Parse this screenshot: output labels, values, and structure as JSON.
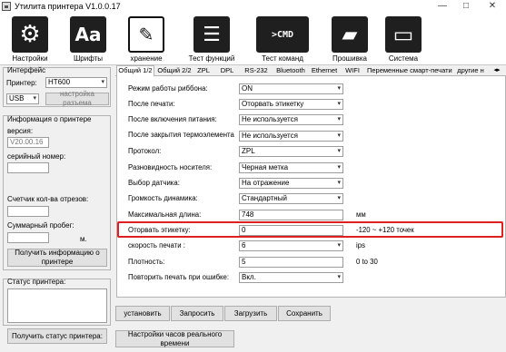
{
  "window": {
    "title": "Утилита принтера  V1.0.0.17",
    "minimize_glyph": "—",
    "maximize_glyph": "□",
    "close_glyph": "✕"
  },
  "toolbar": {
    "items": [
      {
        "label": "Настройки",
        "icon": "gear-icon",
        "glyph": "⚙"
      },
      {
        "label": "Шрифты",
        "icon": "font-icon",
        "glyph": "Aa"
      },
      {
        "label": "хранение",
        "icon": "storage-icon",
        "glyph": "✎"
      },
      {
        "label": "Тест функций",
        "icon": "list-icon",
        "glyph": "☰"
      },
      {
        "label": "Тест команд",
        "icon": "command-icon",
        "glyph": ">CMD"
      },
      {
        "label": "Прошивка",
        "icon": "chip-icon",
        "glyph": "▰"
      },
      {
        "label": "Система",
        "icon": "monitor-icon",
        "glyph": "▭"
      }
    ]
  },
  "left": {
    "interface_group": "Интерфейс",
    "printer_label": "Принтер:",
    "printer_value": "HT600",
    "port_value": "USB",
    "port_settings_button": "настройка разъема",
    "info_group": "Информация о принтере",
    "version_label": "версия:",
    "version_value": "V20.00.16",
    "serial_label": "серийный номер:",
    "serial_value": "",
    "cut_counter_label": "Счетчик кол-ва отрезов:",
    "cut_counter_value": "",
    "total_run_label": "Суммарный пробег:",
    "total_run_value": "",
    "total_run_unit": "м.",
    "get_info_button": "Получить информацию о принтере",
    "status_group": "Статус принтера:",
    "status_value": "",
    "get_status_button": "Получить статус принтера:"
  },
  "tabs": [
    "Общий 1/2",
    "Общий 2/2",
    "ZPL",
    "DPL",
    "RS-232",
    "Bluetooth",
    "Ethernet",
    "WIFI",
    "Переменные смарт-печати",
    "другие н"
  ],
  "tab_scroll_glyph": "◂▸",
  "settings": {
    "rows": [
      {
        "label": "Режим работы риббона:",
        "type": "combo",
        "value": "ON",
        "unit": ""
      },
      {
        "label": "После печати:",
        "type": "combo",
        "value": "Оторвать этикетку",
        "unit": ""
      },
      {
        "label": "После включения питания:",
        "type": "combo",
        "value": "Не используется",
        "unit": ""
      },
      {
        "label": "После закрытия термоэлемента",
        "type": "combo",
        "value": "Не используется",
        "unit": ""
      },
      {
        "label": "Протокол:",
        "type": "combo",
        "value": "ZPL",
        "unit": ""
      },
      {
        "label": "Разновидность носителя:",
        "type": "combo",
        "value": "Черная метка",
        "unit": ""
      },
      {
        "label": "Выбор датчика:",
        "type": "combo",
        "value": "На отражение",
        "unit": ""
      },
      {
        "label": "Громкость динамика:",
        "type": "combo",
        "value": "Стандартный",
        "unit": ""
      },
      {
        "label": "Максимальная длина:",
        "type": "input",
        "value": "748",
        "unit": "мм"
      },
      {
        "label": "Оторвать этикетку:",
        "type": "input",
        "value": "0",
        "unit": "-120 ~ +120 точек"
      },
      {
        "label": "скорость печати :",
        "type": "combo",
        "value": "6",
        "unit": "ips"
      },
      {
        "label": "Плотность:",
        "type": "input",
        "value": "5",
        "unit": "0 to 30"
      },
      {
        "label": "Повторить печать при ошибке:",
        "type": "combo",
        "value": "Вкл.",
        "unit": ""
      }
    ]
  },
  "actions": {
    "set": "установить",
    "request": "Запросить",
    "load": "Загрузить",
    "save": "Сохранить",
    "rtc": "Настройки часов реального времени"
  }
}
